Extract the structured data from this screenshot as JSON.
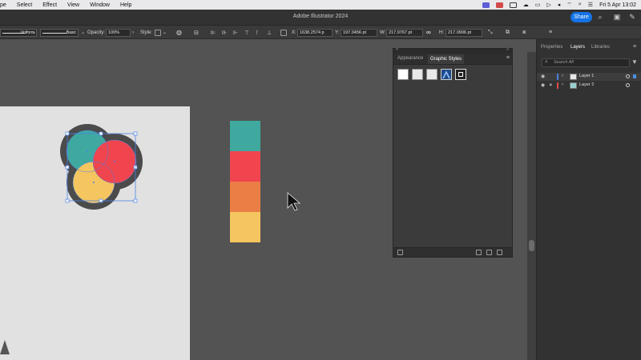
{
  "menubar": {
    "items": [
      "pe",
      "Select",
      "Effect",
      "View",
      "Window",
      "Help"
    ],
    "date_time": "Fri 5 Apr  13:02"
  },
  "app": {
    "title": "Adobe Illustrator 2024",
    "share_label": "Share"
  },
  "controlbar": {
    "stroke_profile": "Uniform",
    "brush": "Basic",
    "opacity_label": "Opacity:",
    "opacity_value": "100%",
    "style_label": "Style:",
    "x_label": "X:",
    "x_value": "1638.2574 p",
    "y_label": "Y:",
    "y_value": "197.0456 pt",
    "w_label": "W:",
    "w_value": "217.9767 pt",
    "h_label": "H:",
    "h_value": "217.0906 pt"
  },
  "graphic_styles_panel": {
    "tabs": [
      "Appearance",
      "Graphic Styles"
    ],
    "active_tab": "Graphic Styles"
  },
  "right_dock": {
    "tabs": [
      "Properties",
      "Layers",
      "Libraries"
    ],
    "active_tab": "Layers",
    "search_placeholder": "Search All",
    "layers": [
      {
        "name": "Layer 1",
        "color": "#4a7fe0"
      },
      {
        "name": "Layer 2",
        "color": "#e04a4a"
      }
    ]
  },
  "swatches": [
    "#3fa99f",
    "#f0454f",
    "#eb7e45",
    "#f5c55f"
  ],
  "circles": {
    "teal": "#3fa99f",
    "red": "#f0454f",
    "yellow": "#f5c55f",
    "outline": "#4b4b4b"
  }
}
